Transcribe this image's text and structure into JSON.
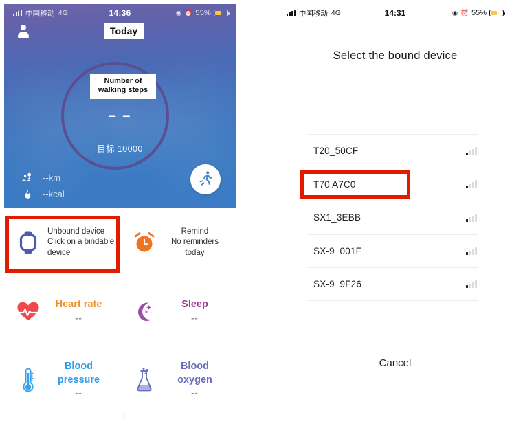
{
  "left_phone": {
    "status_bar": {
      "signal_icon": "signal-bars-icon",
      "carrier": "中国移动",
      "network": "4G",
      "time": "14:36",
      "location_icon": "location-arrow-icon",
      "alarm_icon": "alarm-clock-icon",
      "battery_percent": "55%",
      "battery_level": 55,
      "battery_color": "#f6c945"
    },
    "header": {
      "avatar_icon": "user-avatar-icon",
      "today_label": "Today"
    },
    "hero": {
      "ring_color": "#5b4f92",
      "steps_label": "Number of walking steps",
      "steps_value": "– –",
      "goal_text": "目标 10000",
      "distance_icon": "route-location-icon",
      "distance_value": "--km",
      "calories_icon": "flame-icon",
      "calories_value": "--kcal",
      "run_button_icon": "running-person-icon"
    },
    "tiles": [
      {
        "icon": "smartwatch-icon",
        "icon_color": "#4a5bb0",
        "title": "Unbound device",
        "line2": "Click on a bindable",
        "line3": "device",
        "layout": "left"
      },
      {
        "icon": "alarm-clock-icon",
        "icon_color": "#ef7421",
        "title": "Remind",
        "line2": "No reminders today",
        "layout": "center"
      },
      {
        "icon": "heart-pulse-icon",
        "icon_color": "#f0484a",
        "title": "Heart rate",
        "title_color": "#f0912b",
        "value": "--",
        "layout": "center-big"
      },
      {
        "icon": "moon-stars-icon",
        "icon_color": "#9b4fa8",
        "title": "Sleep",
        "title_color": "#9c3f8f",
        "value": "--",
        "layout": "center-big"
      },
      {
        "icon": "thermometer-icon",
        "icon_color": "#3aa2e8",
        "title": "Blood pressure",
        "title_color": "#2e9ce8",
        "value": "--",
        "layout": "center-big"
      },
      {
        "icon": "flask-icon",
        "icon_color": "#6b6fc4",
        "title": "Blood oxygen",
        "title_color": "#6a6ec2",
        "value": "--",
        "layout": "center-big"
      }
    ]
  },
  "right_phone": {
    "status_bar": {
      "signal_icon": "signal-bars-icon",
      "carrier": "中国移动",
      "network": "4G",
      "time": "14:31",
      "location_icon": "location-arrow-icon",
      "alarm_icon": "alarm-clock-icon",
      "battery_percent": "55%",
      "battery_level": 55,
      "battery_color": "#f6c945"
    },
    "title": "Select the bound device",
    "devices": [
      {
        "name": "T20_50CF",
        "signal_icon": "signal-strength-icon",
        "highlighted": false
      },
      {
        "name": "T70 A7C0",
        "signal_icon": "signal-strength-icon",
        "highlighted": true
      },
      {
        "name": "SX1_3EBB",
        "signal_icon": "signal-strength-icon",
        "highlighted": false
      },
      {
        "name": "SX-9_001F",
        "signal_icon": "signal-strength-icon",
        "highlighted": false
      },
      {
        "name": "SX-9_9F26",
        "signal_icon": "signal-strength-icon",
        "highlighted": false
      }
    ],
    "cancel_label": "Cancel"
  },
  "annotations": {
    "color": "#e01b00",
    "left_target": "unbound-device-tile",
    "right_target": "device-row-T70-A7C0"
  }
}
